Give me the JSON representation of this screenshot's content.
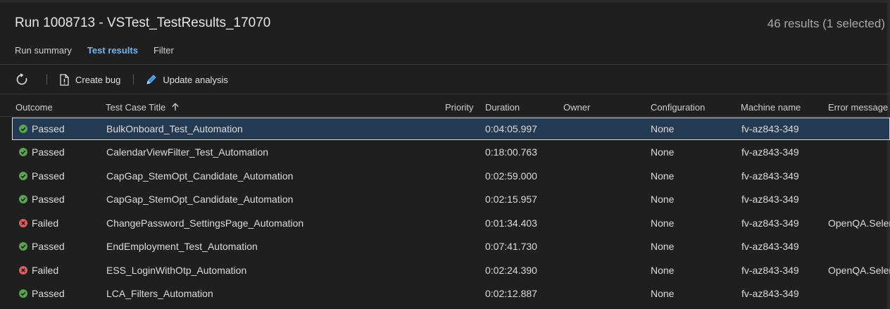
{
  "header": {
    "title": "Run 1008713 - VSTest_TestResults_17070",
    "results_count": "46 results (1 selected)"
  },
  "tabs": [
    {
      "label": "Run summary"
    },
    {
      "label": "Test results"
    },
    {
      "label": "Filter"
    }
  ],
  "toolbar": {
    "refresh_icon": "refresh-icon",
    "create_bug_label": "Create bug",
    "update_analysis_label": "Update analysis"
  },
  "columns": {
    "outcome": "Outcome",
    "title": "Test Case Title",
    "priority": "Priority",
    "duration": "Duration",
    "owner": "Owner",
    "configuration": "Configuration",
    "machine": "Machine name",
    "error": "Error message"
  },
  "colors": {
    "passed": "#57a64a",
    "failed": "#e05c5c",
    "accent": "#6cb8f6"
  },
  "rows": [
    {
      "outcome": "Passed",
      "title": "BulkOnboard_Test_Automation",
      "priority": "",
      "duration": "0:04:05.997",
      "owner": "",
      "configuration": "None",
      "machine": "fv-az843-349",
      "error": ""
    },
    {
      "outcome": "Passed",
      "title": "CalendarViewFilter_Test_Automation",
      "priority": "",
      "duration": "0:18:00.763",
      "owner": "",
      "configuration": "None",
      "machine": "fv-az843-349",
      "error": ""
    },
    {
      "outcome": "Passed",
      "title": "CapGap_StemOpt_Candidate_Automation",
      "priority": "",
      "duration": "0:02:59.000",
      "owner": "",
      "configuration": "None",
      "machine": "fv-az843-349",
      "error": ""
    },
    {
      "outcome": "Passed",
      "title": "CapGap_StemOpt_Candidate_Automation",
      "priority": "",
      "duration": "0:02:15.957",
      "owner": "",
      "configuration": "None",
      "machine": "fv-az843-349",
      "error": ""
    },
    {
      "outcome": "Failed",
      "title": "ChangePassword_SettingsPage_Automation",
      "priority": "",
      "duration": "0:01:34.403",
      "owner": "",
      "configuration": "None",
      "machine": "fv-az843-349",
      "error": "OpenQA.Seler"
    },
    {
      "outcome": "Passed",
      "title": "EndEmployment_Test_Automation",
      "priority": "",
      "duration": "0:07:41.730",
      "owner": "",
      "configuration": "None",
      "machine": "fv-az843-349",
      "error": ""
    },
    {
      "outcome": "Failed",
      "title": "ESS_LoginWithOtp_Automation",
      "priority": "",
      "duration": "0:02:24.390",
      "owner": "",
      "configuration": "None",
      "machine": "fv-az843-349",
      "error": "OpenQA.Seler"
    },
    {
      "outcome": "Passed",
      "title": "LCA_Filters_Automation",
      "priority": "",
      "duration": "0:02:12.887",
      "owner": "",
      "configuration": "None",
      "machine": "fv-az843-349",
      "error": ""
    }
  ]
}
